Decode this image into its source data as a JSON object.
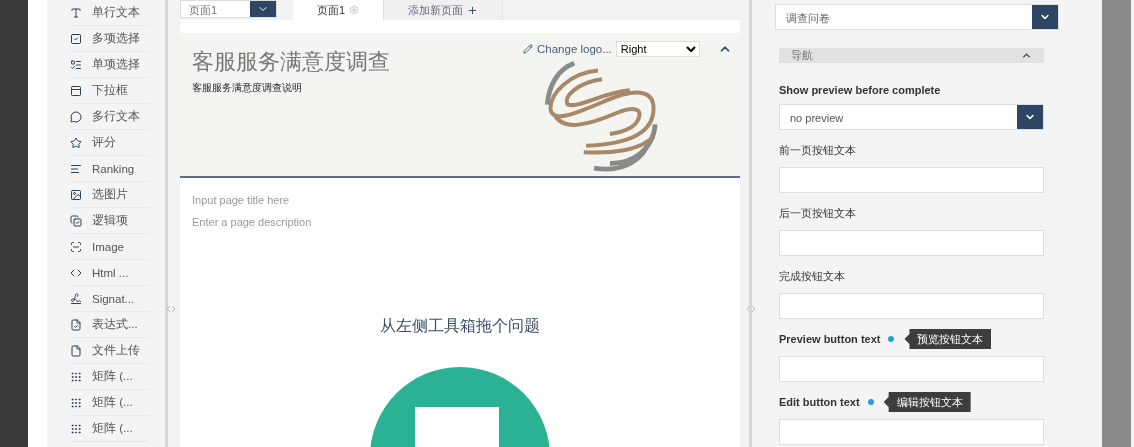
{
  "page_selector": {
    "value": "页面1"
  },
  "tabs": [
    {
      "label": "页面1",
      "selected": true
    },
    {
      "label": "添加新页面",
      "selected": false
    }
  ],
  "toolbox": {
    "items": [
      {
        "label": "单行文本"
      },
      {
        "label": "多项选择"
      },
      {
        "label": "单项选择"
      },
      {
        "label": "下拉框"
      },
      {
        "label": "多行文本"
      },
      {
        "label": "评分"
      },
      {
        "label": "Ranking"
      },
      {
        "label": "选图片"
      },
      {
        "label": "逻辑项"
      },
      {
        "label": "Image"
      },
      {
        "label": "Html ..."
      },
      {
        "label": "Signat..."
      },
      {
        "label": "表达式..."
      },
      {
        "label": "文件上传"
      },
      {
        "label": "矩阵 (..."
      },
      {
        "label": "矩阵 (..."
      },
      {
        "label": "矩阵 (..."
      }
    ]
  },
  "survey": {
    "title": "客服服务满意度调查",
    "description": "客服服务满意度调查说明",
    "logo_button": "Change logo...",
    "logo_position": "Right",
    "header_expanded": true,
    "page_title_placeholder": "Input page title here",
    "page_description_placeholder": "Enter a page description",
    "drop_hint": "从左侧工具箱拖个问题"
  },
  "properties": {
    "object_select": "调查问卷",
    "section": {
      "title": "导航",
      "expanded": true
    },
    "fields": [
      {
        "kind": "select",
        "label": "Show preview before complete",
        "value": "no preview"
      },
      {
        "kind": "text",
        "label": "前一页按钮文本"
      },
      {
        "kind": "text",
        "label": "后一页按钮文本"
      },
      {
        "kind": "text",
        "label": "完成按钮文本"
      },
      {
        "kind": "text",
        "label": "Preview button text",
        "tooltip": "预览按钮文本"
      },
      {
        "kind": "text",
        "label": "Edit button text",
        "tooltip": "编辑按钮文本"
      }
    ]
  }
}
